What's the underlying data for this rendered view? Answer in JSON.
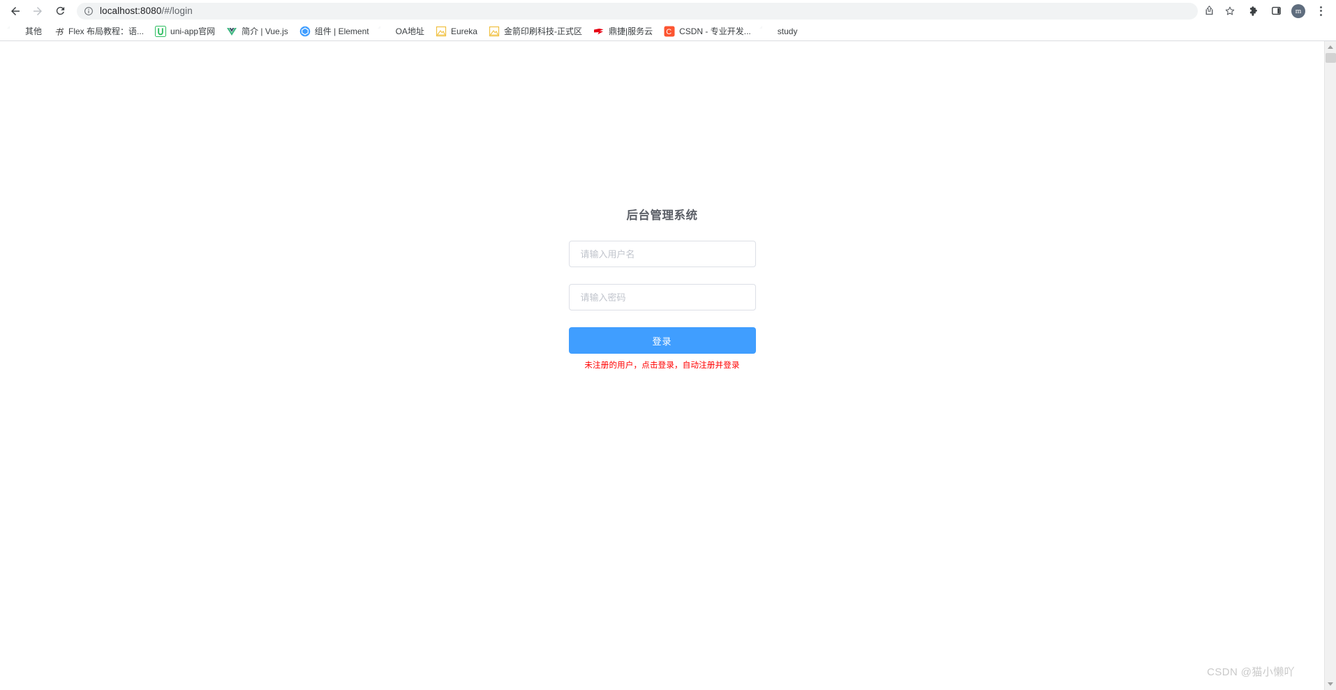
{
  "browser": {
    "nav": {
      "back_label": "Back",
      "forward_label": "Forward",
      "reload_label": "Reload"
    },
    "omnibox": {
      "site_info_icon": "info-circle-icon",
      "url_host": "localhost:8080",
      "url_path": "/#/login",
      "share_label": "Share",
      "bookmark_label": "Bookmark this tab"
    },
    "actions": {
      "extensions_label": "Extensions",
      "side_panel_label": "Side panel",
      "profile_initial": "m",
      "menu_label": "Customize and control Google Chrome"
    },
    "bookmarks": [
      {
        "label": "其他",
        "icon": "folder-icon"
      },
      {
        "label": "Flex 布局教程：语...",
        "icon": "book-icon"
      },
      {
        "label": "uni-app官网",
        "icon": "uniapp-icon"
      },
      {
        "label": "简介 | Vue.js",
        "icon": "vue-icon"
      },
      {
        "label": "组件 | Element",
        "icon": "element-icon"
      },
      {
        "label": "OA地址",
        "icon": "folder-icon"
      },
      {
        "label": "Eureka",
        "icon": "generic-page-icon"
      },
      {
        "label": "金箭印刷科技-正式区",
        "icon": "generic-page-icon"
      },
      {
        "label": "鼎捷|服务云",
        "icon": "digiwin-icon"
      },
      {
        "label": "CSDN - 专业开发...",
        "icon": "csdn-icon"
      },
      {
        "label": "study",
        "icon": "folder-icon"
      }
    ]
  },
  "login": {
    "title": "后台管理系统",
    "username": {
      "value": "",
      "placeholder": "请输入用户名"
    },
    "password": {
      "value": "",
      "placeholder": "请输入密码"
    },
    "submit_label": "登录",
    "hint": "未注册的用户，点击登录，自动注册并登录",
    "accent_color": "#409eff",
    "hint_color": "#ff0000"
  },
  "watermark": "CSDN @猫小懒吖"
}
